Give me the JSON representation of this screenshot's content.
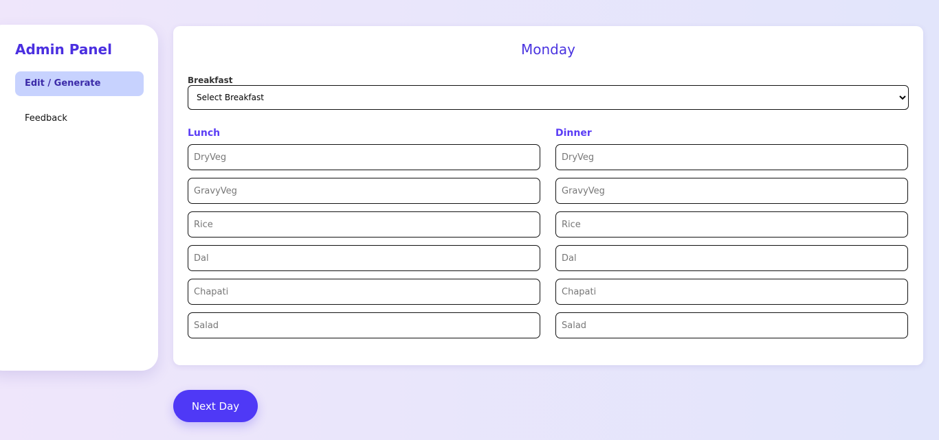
{
  "sidebar": {
    "title": "Admin Panel",
    "items": [
      {
        "label": "Edit / Generate",
        "active": true
      },
      {
        "label": "Feedback",
        "active": false
      }
    ]
  },
  "main": {
    "day": "Monday",
    "breakfast_label": "Breakfast",
    "breakfast_value": "Select Breakfast",
    "lunch": {
      "title": "Lunch",
      "fields": [
        "DryVeg",
        "GravyVeg",
        "Rice",
        "Dal",
        "Chapati",
        "Salad"
      ]
    },
    "dinner": {
      "title": "Dinner",
      "fields": [
        "DryVeg",
        "GravyVeg",
        "Rice",
        "Dal",
        "Chapati",
        "Salad"
      ]
    }
  },
  "next_label": "Next Day"
}
